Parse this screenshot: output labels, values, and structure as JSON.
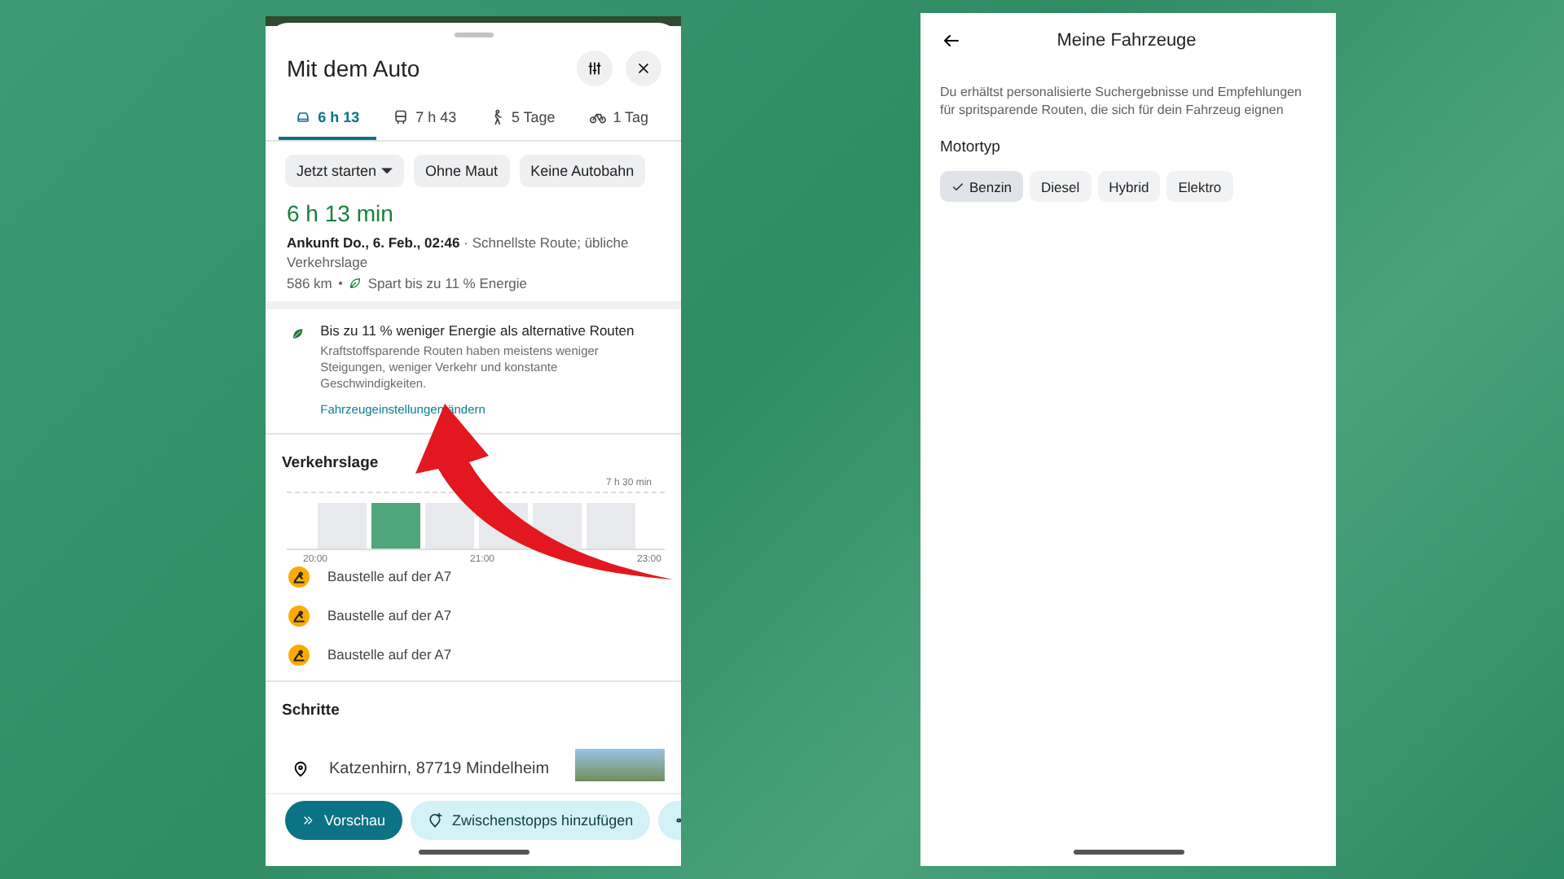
{
  "route_sheet": {
    "title": "Mit dem Auto",
    "modes": [
      {
        "kind": "car",
        "label": "6 h 13",
        "selected": true
      },
      {
        "kind": "transit",
        "label": "7 h 43",
        "selected": false
      },
      {
        "kind": "walk",
        "label": "5 Tage",
        "selected": false
      },
      {
        "kind": "bike",
        "label": "1 Tag",
        "selected": false
      }
    ],
    "chips": [
      {
        "label": "Jetzt starten",
        "dropdown": true
      },
      {
        "label": "Ohne Maut",
        "dropdown": false
      },
      {
        "label": "Keine Autobahn",
        "dropdown": false
      }
    ],
    "duration": "6 h 13 min",
    "arrival": "Ankunft Do., 6. Feb., 02:46",
    "route_note": " · Schnellste Route; übliche Verkehrslage",
    "distance": "586 km",
    "saving": "Spart bis zu 11 % Energie",
    "eco_card": {
      "title": "Bis zu 11 % weniger Energie als alternative Routen",
      "text": "Kraftstoffsparende Routen haben meistens weniger Steigungen, weniger Verkehr und konstante Geschwindigkeiten.",
      "link": "Fahrzeugeinstellungen ändern"
    },
    "traffic": {
      "heading": "Verkehrslage",
      "peak_label": "7 h 30 min",
      "bars": [
        {
          "selected": false
        },
        {
          "selected": true
        },
        {
          "selected": false
        },
        {
          "selected": false
        },
        {
          "selected": false
        },
        {
          "selected": false
        }
      ],
      "time_labels": [
        "20:00",
        "21:00",
        "23:00"
      ],
      "incidents": [
        "Baustelle auf der A7",
        "Baustelle auf der A7",
        "Baustelle auf der A7"
      ]
    },
    "steps": {
      "heading": "Schritte",
      "first_place": "Katzenhirn, 87719 Mindelheim"
    },
    "actions": [
      {
        "kind": "primary",
        "label": "Vorschau"
      },
      {
        "kind": "secondary",
        "label": "Zwischenstopps hinzufügen"
      },
      {
        "kind": "share"
      }
    ]
  },
  "vehicles_screen": {
    "title": "Meine Fahrzeuge",
    "description": "Du erhältst personalisierte Suchergebnisse und Empfehlungen für spritsparende Routen, die sich für dein Fahrzeug eignen",
    "section": "Motortyp",
    "engine_types": [
      {
        "label": "Benzin",
        "selected": true
      },
      {
        "label": "Diesel",
        "selected": false
      },
      {
        "label": "Hybrid",
        "selected": false
      },
      {
        "label": "Elektro",
        "selected": false
      }
    ]
  }
}
